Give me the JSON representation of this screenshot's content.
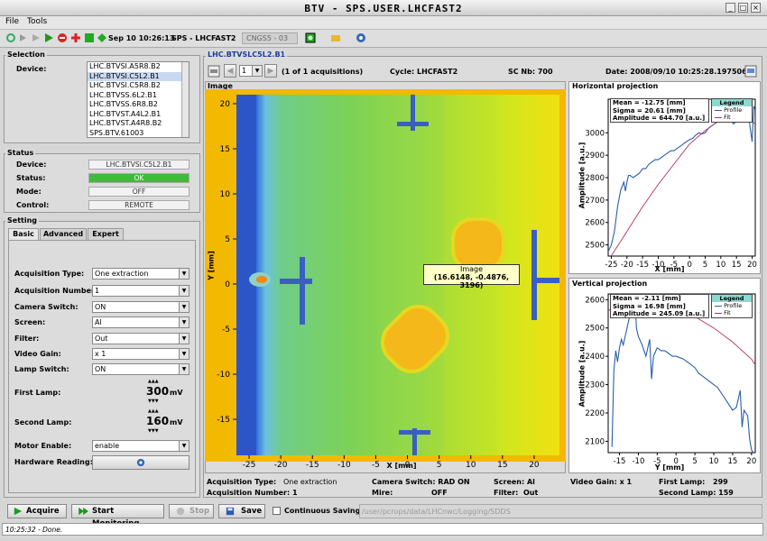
{
  "window": {
    "title": "BTV - SPS.USER.LHCFAST2"
  },
  "menu": {
    "file": "File",
    "tools": "Tools"
  },
  "toolbar": {
    "timestamp": "Sep 10 10:26:13",
    "context": "SPS - LHCFAST2",
    "other_context": "CNGS5 - 03"
  },
  "selection": {
    "title": "Selection",
    "device_label": "Device:",
    "devices": [
      "LHC.BTVSI.A5R8.B2",
      "LHC.BTVSI.C5L2.B1",
      "LHC.BTVSI.C5R8.B2",
      "LHC.BTVSS.6L2.B1",
      "LHC.BTVSS.6R8.B2",
      "LHC.BTVST.A4L2.B1",
      "LHC.BTVST.A4R8.B2",
      "SPS.BTV.61003"
    ]
  },
  "status": {
    "title": "Status",
    "device_label": "Device:",
    "device_value": "LHC.BTVSI.C5L2.B1",
    "status_label": "Status:",
    "status_value": "OK",
    "mode_label": "Mode:",
    "mode_value": "OFF",
    "control_label": "Control:",
    "control_value": "REMOTE",
    "ok_color": "#44b83c"
  },
  "setting": {
    "title": "Setting",
    "tabs": [
      "Basic",
      "Advanced",
      "Expert"
    ],
    "acq_type_label": "Acquisition Type:",
    "acq_type_value": "One extraction",
    "acq_num_label": "Acquisition Number:",
    "acq_num_value": "1",
    "camera_label": "Camera Switch:",
    "camera_value": "ON",
    "screen_label": "Screen:",
    "screen_value": "Al",
    "filter_label": "Filter:",
    "filter_value": "Out",
    "gain_label": "Video Gain:",
    "gain_value": "x 1",
    "lamp_switch_label": "Lamp Switch:",
    "lamp_switch_value": "ON",
    "first_lamp_label": "First Lamp:",
    "first_lamp_value": "300",
    "first_lamp_unit": "mV",
    "second_lamp_label": "Second Lamp:",
    "second_lamp_value": "160",
    "second_lamp_unit": "mV",
    "motor_label": "Motor Enable:",
    "motor_value": "enable",
    "hw_label": "Hardware Reading:"
  },
  "main": {
    "device_title": "LHC.BTVSLC5L2.B1",
    "page_value": "1",
    "acq_count": "(1 of 1 acquisitions)",
    "cycle": "Cycle: LHCFAST2",
    "sc": "SC Nb: 700",
    "date": "Date:  2008/09/10 10:25:28.197506"
  },
  "image": {
    "title": "Image",
    "tooltip_title": "Image",
    "tooltip_value": "(16.6148, -0.4876, 3196)",
    "xlabel": "X [mm]",
    "ylabel": "Y [mm]",
    "xticks": [
      "-25",
      "-20",
      "-15",
      "-10",
      "-5",
      "0",
      "5",
      "10",
      "15",
      "20"
    ],
    "yticks": [
      "20",
      "15",
      "10",
      "5",
      "0",
      "-5",
      "-10",
      "-15"
    ]
  },
  "hproj": {
    "title": "Horizontal projection",
    "mean": "Mean = -12.75 [mm]",
    "sigma": "Sigma = 20.61 [mm]",
    "amplitude": "Amplitude = 644.70 [a.u.]",
    "legend": "Legend",
    "profile": "Profile",
    "fit": "Fit",
    "ylabel": "Amplitude [a.u.]",
    "xlabel": "X [mm]"
  },
  "vproj": {
    "title": "Vertical projection",
    "mean": "Mean = -2.11 [mm]",
    "sigma": "Sigma = 16.98 [mm]",
    "amplitude": "Amplitude = 245.09 [a.u.]",
    "legend": "Legend",
    "profile": "Profile",
    "fit": "Fit",
    "ylabel": "Amplitude [a.u.]",
    "xlabel": "Y [mm]"
  },
  "chart_data": [
    {
      "type": "line",
      "title": "Horizontal projection",
      "xlabel": "X [mm]",
      "ylabel": "Amplitude [a.u.]",
      "xlim": [
        -26,
        21
      ],
      "ylim": [
        2450,
        3150
      ],
      "xticks": [
        -25,
        -20,
        -15,
        -10,
        -5,
        0,
        5,
        10,
        15,
        20
      ],
      "yticks": [
        2500,
        2600,
        2700,
        2800,
        2900,
        3000
      ],
      "series": [
        {
          "name": "Profile",
          "x": [
            -26,
            -25,
            -24,
            -23,
            -22,
            -21,
            -20.5,
            -20,
            -19.5,
            -19,
            -18,
            -17,
            -16,
            -15,
            -14,
            -13,
            -12,
            -11,
            -10,
            -9,
            -8,
            -7,
            -6,
            -5,
            -4,
            -3,
            -2,
            -1,
            0,
            1,
            2,
            3,
            4,
            5,
            6,
            7,
            8,
            9,
            10,
            11,
            12,
            13,
            14,
            15,
            16,
            17,
            18,
            19,
            20,
            20.5,
            21
          ],
          "y": [
            2470,
            2500,
            2560,
            2670,
            2745,
            2780,
            2740,
            2780,
            2810,
            2810,
            2800,
            2810,
            2820,
            2840,
            2840,
            2860,
            2870,
            2880,
            2880,
            2890,
            2900,
            2910,
            2920,
            2920,
            2930,
            2940,
            2950,
            2960,
            2970,
            2975,
            2990,
            3000,
            2995,
            3000,
            3020,
            3030,
            3040,
            3050,
            3060,
            3070,
            3080,
            3060,
            3040,
            3050,
            3080,
            3100,
            3095,
            3060,
            2960,
            3120,
            3100
          ]
        },
        {
          "name": "Fit",
          "x": [
            -26,
            -20,
            -15,
            -10,
            -5,
            0,
            5,
            10,
            15,
            20,
            21
          ],
          "y": [
            2430,
            2560,
            2670,
            2770,
            2860,
            2950,
            3010,
            3060,
            3070,
            3050,
            3040
          ]
        }
      ]
    },
    {
      "type": "line",
      "title": "Vertical projection",
      "xlabel": "Y [mm]",
      "ylabel": "Amplitude [a.u.]",
      "xlim": [
        -18,
        21
      ],
      "ylim": [
        2060,
        2620
      ],
      "xticks": [
        -15,
        -10,
        -5,
        0,
        5,
        10,
        15,
        20
      ],
      "yticks": [
        2100,
        2200,
        2300,
        2400,
        2500,
        2600
      ],
      "series": [
        {
          "name": "Profile",
          "x": [
            -17,
            -16.5,
            -16,
            -15.5,
            -15,
            -14.5,
            -14,
            -13,
            -12,
            -11,
            -10.5,
            -10,
            -9,
            -8,
            -7,
            -6.5,
            -6,
            -5,
            -4,
            -3,
            -2,
            -1,
            0,
            1,
            2,
            3,
            4,
            5,
            6,
            7,
            8,
            9,
            10,
            11,
            12,
            13,
            14,
            15,
            16,
            17,
            17.5,
            18,
            19,
            19.5,
            20,
            20.5
          ],
          "y": [
            2080,
            2350,
            2420,
            2380,
            2430,
            2460,
            2440,
            2500,
            2560,
            2620,
            2500,
            2470,
            2440,
            2400,
            2460,
            2320,
            2400,
            2430,
            2420,
            2420,
            2410,
            2400,
            2400,
            2395,
            2390,
            2380,
            2370,
            2360,
            2340,
            2330,
            2320,
            2310,
            2300,
            2290,
            2270,
            2250,
            2230,
            2210,
            2220,
            2280,
            2150,
            2210,
            2190,
            2110,
            2070,
            2060
          ]
        },
        {
          "name": "Fit",
          "x": [
            -18,
            -15,
            -10,
            -5,
            0,
            5,
            10,
            15,
            20,
            21
          ],
          "y": [
            2560,
            2590,
            2600,
            2590,
            2570,
            2540,
            2500,
            2450,
            2390,
            2370
          ]
        }
      ]
    }
  ],
  "acqinfo": {
    "acq_type_label": "Acquisition Type:",
    "acq_type_value": "One extraction",
    "acq_num_label": "Acquisition Number: 1",
    "camera": "Camera Switch: RAD ON",
    "mire_label": "Mire:",
    "mire_value": "OFF",
    "screen_label": "Screen: Al",
    "filter_label": "Filter:",
    "filter_value": "Out",
    "gain": "Video Gain: x 1",
    "first_lamp_label": "First Lamp:",
    "first_lamp_value": "299",
    "second_lamp_label": "Second Lamp: 159"
  },
  "bottom": {
    "acquire": "Acquire",
    "start_monitoring": "Start Monitoring",
    "stop": "Stop",
    "save": "Save",
    "continuous": "Continuous Saving",
    "path": "/user/pcrops/data/LHCnwc/Logging/SDDS"
  },
  "statusbar": {
    "text": "10:25:32 - Done."
  }
}
